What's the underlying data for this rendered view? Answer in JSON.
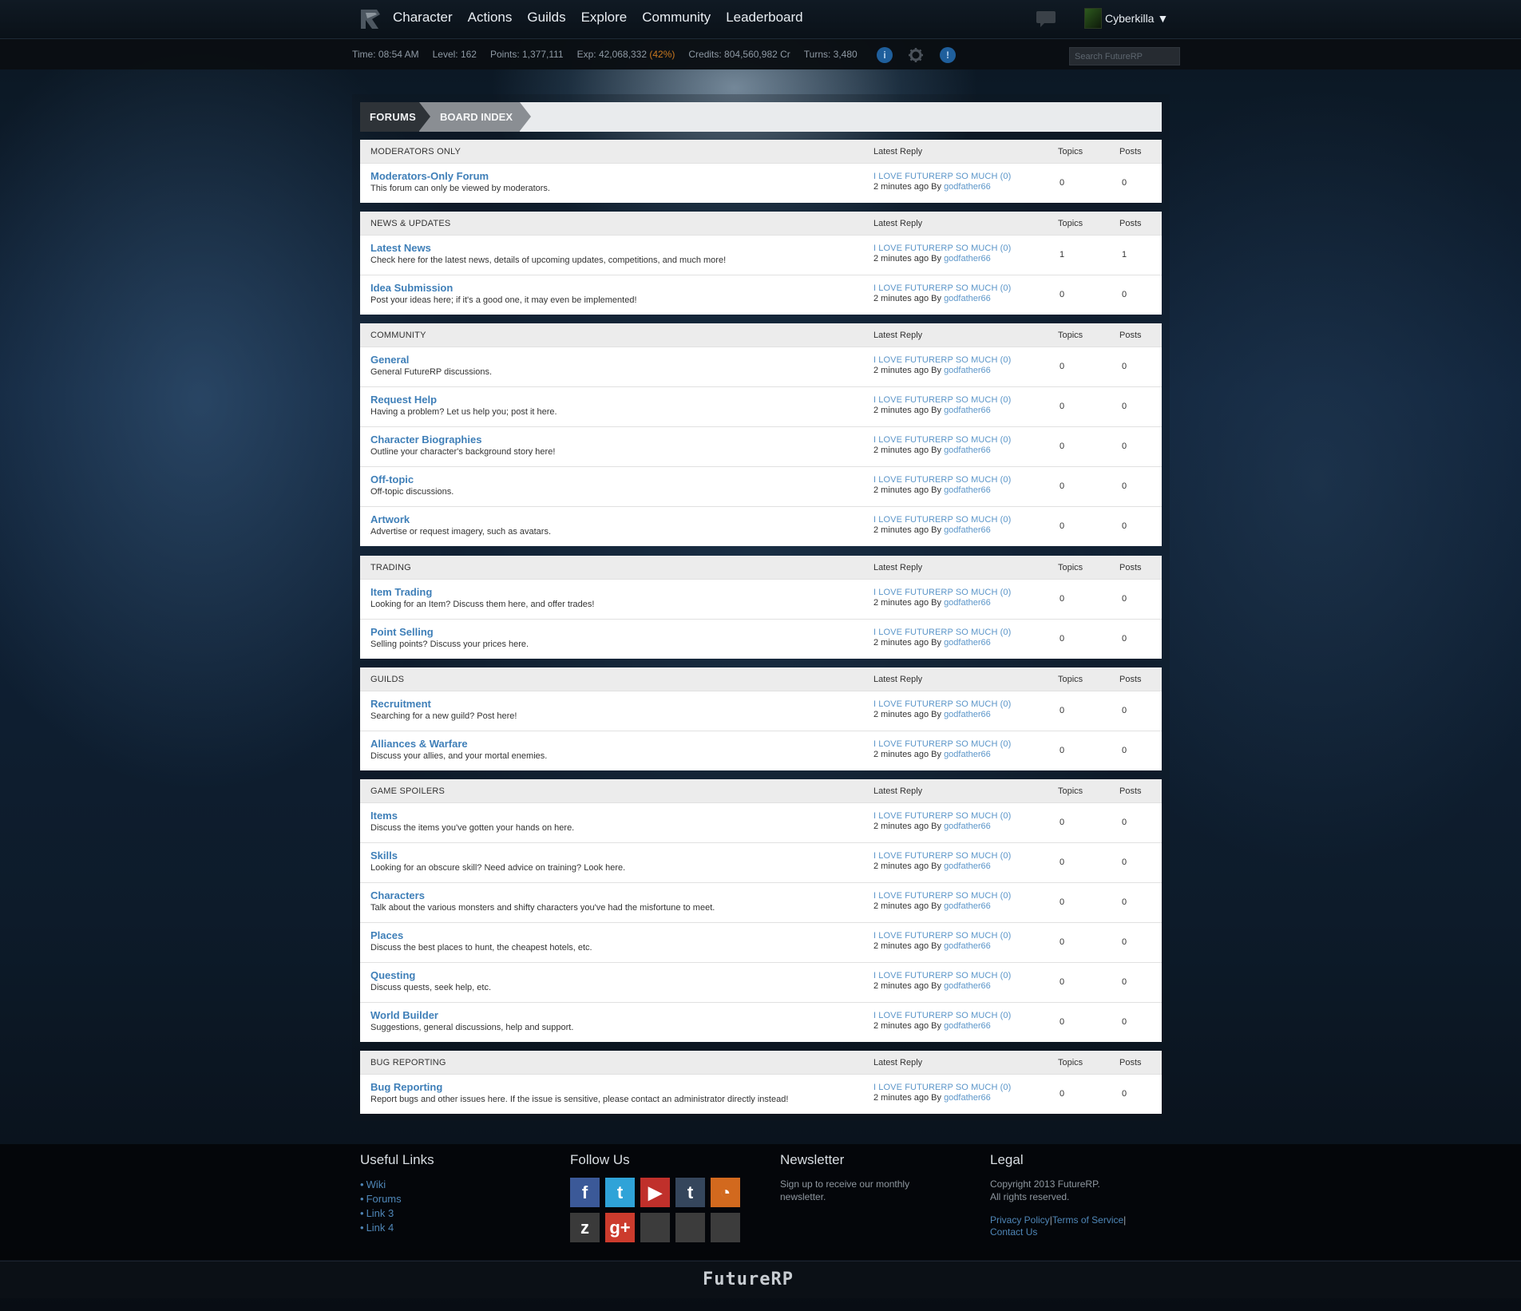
{
  "nav": {
    "items": [
      "Character",
      "Actions",
      "Guilds",
      "Explore",
      "Community",
      "Leaderboard"
    ],
    "username": "Cyberkilla",
    "caret": "▼"
  },
  "status": {
    "time": "Time: 08:54 AM",
    "level": "Level: 162",
    "points": "Points: 1,377,111",
    "exp": "Exp: 42,068,332",
    "exp_pct": "(42%)",
    "credits": "Credits: 804,560,982 Cr",
    "turns": "Turns: 3,480",
    "search_placeholder": "Search FutureRP"
  },
  "breadcrumb": {
    "forums": "FORUMS",
    "board": "BOARD INDEX"
  },
  "column_labels": {
    "latest": "Latest Reply",
    "topics": "Topics",
    "posts": "Posts"
  },
  "sections": [
    {
      "title": "MODERATORS ONLY",
      "forums": [
        {
          "name": "Moderators-Only Forum",
          "desc": "This forum can only be viewed by moderators.",
          "latest": "I LOVE FUTURERP SO MUCH (0)",
          "time": "2 minutes ago By",
          "user": "godfather66",
          "topics": "0",
          "posts": "0"
        }
      ]
    },
    {
      "title": "NEWS & UPDATES",
      "forums": [
        {
          "name": "Latest News",
          "desc": "Check here for the latest news, details of upcoming updates, competitions, and much more!",
          "latest": "I LOVE FUTURERP SO MUCH (0)",
          "time": "2 minutes ago By",
          "user": "godfather66",
          "topics": "1",
          "posts": "1"
        },
        {
          "name": "Idea Submission",
          "desc": "Post your ideas here; if it's a good one, it may even be implemented!",
          "latest": "I LOVE FUTURERP SO MUCH (0)",
          "time": "2 minutes ago By",
          "user": "godfather66",
          "topics": "0",
          "posts": "0"
        }
      ]
    },
    {
      "title": "COMMUNITY",
      "forums": [
        {
          "name": "General",
          "desc": "General FutureRP discussions.",
          "latest": "I LOVE FUTURERP SO MUCH (0)",
          "time": "2 minutes ago By",
          "user": "godfather66",
          "topics": "0",
          "posts": "0"
        },
        {
          "name": "Request Help",
          "desc": "Having a problem? Let us help you; post it here.",
          "latest": "I LOVE FUTURERP SO MUCH (0)",
          "time": "2 minutes ago By",
          "user": "godfather66",
          "topics": "0",
          "posts": "0"
        },
        {
          "name": "Character Biographies",
          "desc": "Outline your character's background story here!",
          "latest": "I LOVE FUTURERP SO MUCH (0)",
          "time": "2 minutes ago By",
          "user": "godfather66",
          "topics": "0",
          "posts": "0"
        },
        {
          "name": "Off-topic",
          "desc": "Off-topic discussions.",
          "latest": "I LOVE FUTURERP SO MUCH (0)",
          "time": "2 minutes ago By",
          "user": "godfather66",
          "topics": "0",
          "posts": "0"
        },
        {
          "name": "Artwork",
          "desc": "Advertise or request imagery, such as avatars.",
          "latest": "I LOVE FUTURERP SO MUCH (0)",
          "time": "2 minutes ago By",
          "user": "godfather66",
          "topics": "0",
          "posts": "0"
        }
      ]
    },
    {
      "title": "TRADING",
      "forums": [
        {
          "name": "Item Trading",
          "desc": "Looking for an Item? Discuss them here, and offer trades!",
          "latest": "I LOVE FUTURERP SO MUCH (0)",
          "time": "2 minutes ago By",
          "user": "godfather66",
          "topics": "0",
          "posts": "0"
        },
        {
          "name": "Point Selling",
          "desc": "Selling points? Discuss your prices here.",
          "latest": "I LOVE FUTURERP SO MUCH (0)",
          "time": "2 minutes ago By",
          "user": "godfather66",
          "topics": "0",
          "posts": "0"
        }
      ]
    },
    {
      "title": "GUILDS",
      "forums": [
        {
          "name": "Recruitment",
          "desc": "Searching for a new guild? Post here!",
          "latest": "I LOVE FUTURERP SO MUCH (0)",
          "time": "2 minutes ago By",
          "user": "godfather66",
          "topics": "0",
          "posts": "0"
        },
        {
          "name": "Alliances & Warfare",
          "desc": "Discuss your allies, and your mortal enemies.",
          "latest": "I LOVE FUTURERP SO MUCH (0)",
          "time": "2 minutes ago By",
          "user": "godfather66",
          "topics": "0",
          "posts": "0"
        }
      ]
    },
    {
      "title": "GAME SPOILERS",
      "forums": [
        {
          "name": "Items",
          "desc": "Discuss the items you've gotten your hands on here.",
          "latest": "I LOVE FUTURERP SO MUCH (0)",
          "time": "2 minutes ago By",
          "user": "godfather66",
          "topics": "0",
          "posts": "0"
        },
        {
          "name": "Skills",
          "desc": "Looking for an obscure skill? Need advice on training? Look here.",
          "latest": "I LOVE FUTURERP SO MUCH (0)",
          "time": "2 minutes ago By",
          "user": "godfather66",
          "topics": "0",
          "posts": "0"
        },
        {
          "name": "Characters",
          "desc": "Talk about the various monsters and shifty characters you've had the misfortune to meet.",
          "latest": "I LOVE FUTURERP SO MUCH (0)",
          "time": "2 minutes ago By",
          "user": "godfather66",
          "topics": "0",
          "posts": "0"
        },
        {
          "name": "Places",
          "desc": "Discuss the best places to hunt, the cheapest hotels, etc.",
          "latest": "I LOVE FUTURERP SO MUCH (0)",
          "time": "2 minutes ago By",
          "user": "godfather66",
          "topics": "0",
          "posts": "0"
        },
        {
          "name": "Questing",
          "desc": "Discuss quests, seek help, etc.",
          "latest": "I LOVE FUTURERP SO MUCH (0)",
          "time": "2 minutes ago By",
          "user": "godfather66",
          "topics": "0",
          "posts": "0"
        },
        {
          "name": "World Builder",
          "desc": "Suggestions, general discussions, help and support.",
          "latest": "I LOVE FUTURERP SO MUCH (0)",
          "time": "2 minutes ago By",
          "user": "godfather66",
          "topics": "0",
          "posts": "0"
        }
      ]
    },
    {
      "title": "BUG REPORTING",
      "forums": [
        {
          "name": "Bug Reporting",
          "desc": "Report bugs and other issues here. If the issue is sensitive, please contact an administrator directly instead!",
          "latest": "I LOVE FUTURERP SO MUCH (0)",
          "time": "2 minutes ago By",
          "user": "godfather66",
          "topics": "0",
          "posts": "0"
        }
      ]
    }
  ],
  "footer": {
    "useful_heading": "Useful Links",
    "useful_links": [
      "Wiki",
      "Forums",
      "Link 3",
      "Link 4"
    ],
    "follow_heading": "Follow Us",
    "social": [
      {
        "icon": "facebook-icon",
        "glyph": "f",
        "color": "#3b5998"
      },
      {
        "icon": "twitter-icon",
        "glyph": "t",
        "color": "#2fa3d8"
      },
      {
        "icon": "youtube-icon",
        "glyph": "▶",
        "color": "#c0302b"
      },
      {
        "icon": "tumblr-icon",
        "glyph": "t",
        "color": "#35465c"
      },
      {
        "icon": "rss-icon",
        "glyph": "◔",
        "color": "#d2691e"
      },
      {
        "icon": "zerply-icon",
        "glyph": "z",
        "color": "#3a3a3a"
      },
      {
        "icon": "googleplus-icon",
        "glyph": "g+",
        "color": "#cc3b2d"
      },
      {
        "icon": "empty-social-icon",
        "glyph": "",
        "color": "#3c3c3c"
      },
      {
        "icon": "empty-social-icon",
        "glyph": "",
        "color": "#3c3c3c"
      },
      {
        "icon": "empty-social-icon",
        "glyph": "",
        "color": "#3c3c3c"
      }
    ],
    "newsletter_heading": "Newsletter",
    "newsletter_text": "Sign up to receive our monthly newsletter.",
    "legal_heading": "Legal",
    "copyright": "Copyright 2013 FutureRP.",
    "rights": "All rights reserved.",
    "privacy": "Privacy Policy",
    "terms": "Terms of Service",
    "contact": "Contact Us"
  },
  "brand": "FutureRP"
}
